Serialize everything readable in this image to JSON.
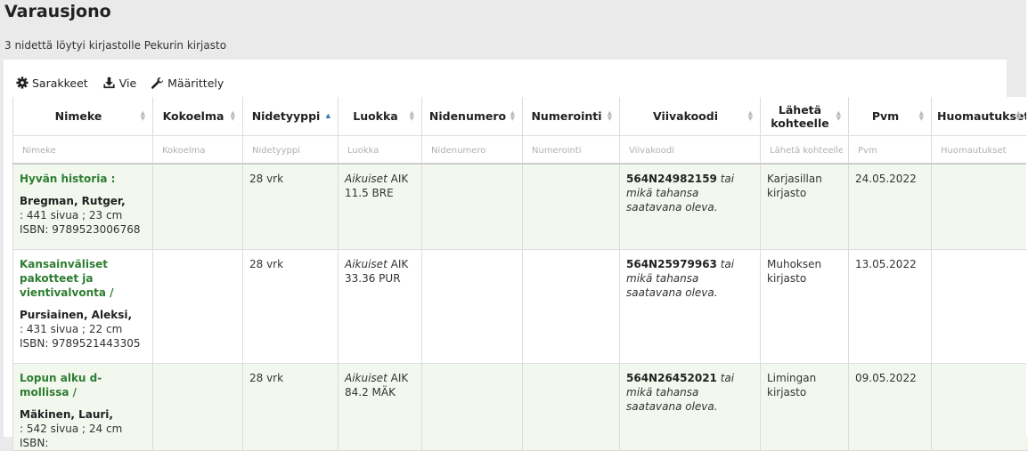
{
  "page": {
    "title": "Varausjono",
    "summary": "3 nidettä löytyi kirjastolle Pekurin kirjasto"
  },
  "toolbar": {
    "columns_label": "Sarakkeet",
    "export_label": "Vie",
    "settings_label": "Määrittely"
  },
  "table": {
    "headers": [
      "Nimeke",
      "Kokoelma",
      "Nidetyyppi",
      "Luokka",
      "Nidenumero",
      "Numerointi",
      "Viivakoodi",
      "Lähetä kohteelle",
      "Pvm",
      "Huomautukset"
    ],
    "filters": [
      "Nimeke",
      "Kokoelma",
      "Nidetyyppi",
      "Luokka",
      "Nidenumero",
      "Numerointi",
      "Viivakoodi",
      "Lähetä kohteelle",
      "Pvm",
      "Huomautukset"
    ],
    "sorted_column": "Nidetyyppi",
    "rows": [
      {
        "title": "Hyvän historia :",
        "author": "Bregman, Rutger,",
        "description": ": 441 sivua ; 23 cm ISBN: 9789523006768",
        "collection": "",
        "itemtype": "28 vrk",
        "location_italic": "Aikuiset",
        "location_rest": "AIK 11.5 BRE",
        "item_number": "",
        "numbering": "",
        "barcode": "564N24982159",
        "barcode_note": "tai mikä tahansa saatavana oleva.",
        "send_to": "Karjasillan kirjasto",
        "date": "24.05.2022",
        "notes": ""
      },
      {
        "title": "Kansainväliset pakotteet ja vientivalvonta /",
        "author": "Pursiainen, Aleksi,",
        "description": ": 431 sivua ; 22 cm ISBN: 9789521443305",
        "collection": "",
        "itemtype": "28 vrk",
        "location_italic": "Aikuiset",
        "location_rest": "AIK 33.36 PUR",
        "item_number": "",
        "numbering": "",
        "barcode": "564N25979963",
        "barcode_note": "tai mikä tahansa saatavana oleva.",
        "send_to": "Muhoksen kirjasto",
        "date": "13.05.2022",
        "notes": ""
      },
      {
        "title": "Lopun alku d-mollissa /",
        "author": "Mäkinen, Lauri,",
        "description": ": 542 sivua ; 24 cm ISBN:",
        "collection": "",
        "itemtype": "28 vrk",
        "location_italic": "Aikuiset",
        "location_rest": "AIK 84.2 MÄK",
        "item_number": "",
        "numbering": "",
        "barcode": "564N26452021",
        "barcode_note": "tai mikä tahansa saatavana oleva.",
        "send_to": "Limingan kirjasto",
        "date": "09.05.2022",
        "notes": ""
      }
    ]
  }
}
